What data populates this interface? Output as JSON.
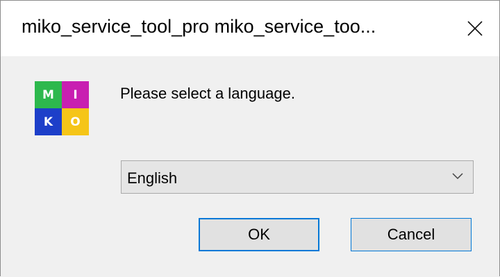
{
  "window": {
    "title": "miko_service_tool_pro miko_service_too..."
  },
  "icons": {
    "close": "close-icon",
    "chevron": "chevron-down-icon"
  },
  "logo": {
    "cells": [
      {
        "letter": "M",
        "color": "#2db84d"
      },
      {
        "letter": "I",
        "color": "#c81fb1"
      },
      {
        "letter": "K",
        "color": "#1d3fc9"
      },
      {
        "letter": "O",
        "color": "#f5c518"
      }
    ]
  },
  "dialog": {
    "message": "Please select a language.",
    "language_select": {
      "selected": "English"
    },
    "ok_label": "OK",
    "cancel_label": "Cancel"
  },
  "colors": {
    "accent": "#0078d7",
    "dialog_bg": "#f0f0f0",
    "titlebar_bg": "#ffffff"
  }
}
